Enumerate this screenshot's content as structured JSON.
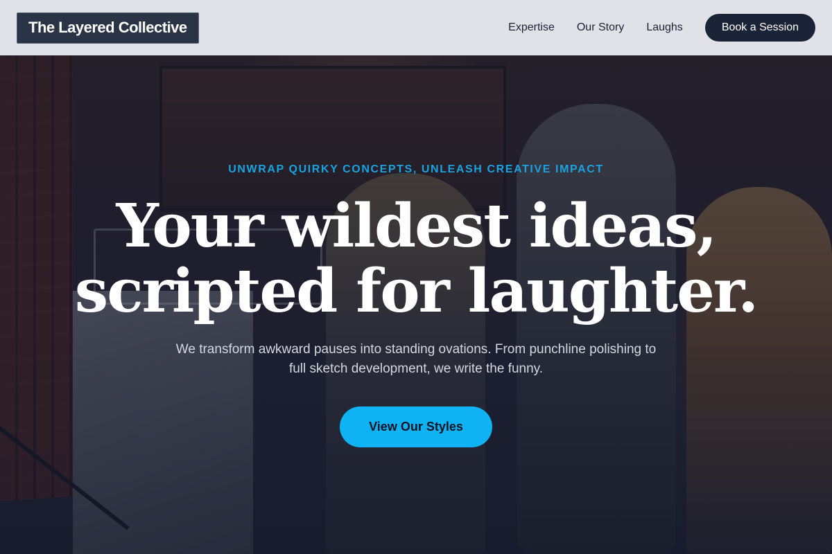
{
  "header": {
    "logo": "The Layered Collective",
    "nav": [
      {
        "label": "Expertise"
      },
      {
        "label": "Our Story"
      },
      {
        "label": "Laughs"
      }
    ],
    "cta_label": "Book a Session"
  },
  "hero": {
    "eyebrow": "UNWRAP QUIRKY CONCEPTS, UNLEASH CREATIVE IMPACT",
    "headline_line1": "Your wildest ideas,",
    "headline_line2": "scripted for laughter.",
    "subcopy": "We transform awkward pauses into standing ovations. From punchline polishing to full sketch development, we write the funny.",
    "button_label": "View Our Styles"
  },
  "colors": {
    "accent": "#0fb2f2",
    "eyebrow": "#1aa3e0",
    "header_bg": "#e8eaf0",
    "dark_button": "#1b2336",
    "logo_bg": "#2b3446"
  }
}
